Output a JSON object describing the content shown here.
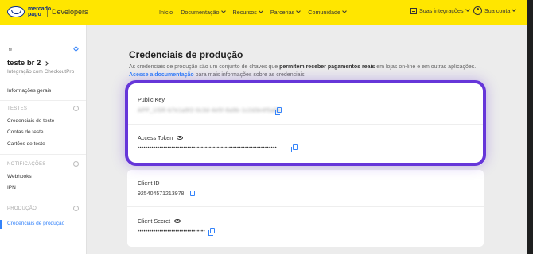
{
  "header": {
    "logo_text_line1": "mercado",
    "logo_text_line2": "pago",
    "product": "Developers",
    "nav": [
      "Início",
      "Documentação",
      "Recursos",
      "Parcerias",
      "Comunidade"
    ],
    "integrations": "Suas integrações",
    "account": "Sua conta"
  },
  "sidebar": {
    "badge": "te",
    "app_name": "teste br 2",
    "app_subtitle": "Integração com CheckoutPro",
    "general_info": "Informações gerais",
    "section_tests": "TESTES",
    "test_credentials": "Credenciais de teste",
    "test_accounts": "Contas de teste",
    "test_cards": "Cartões de teste",
    "section_notifications": "NOTIFICAÇÕES",
    "webhooks": "Webhooks",
    "ipn": "IPN",
    "section_production": "PRODUÇÃO",
    "production_credentials": "Credenciais de produção"
  },
  "main": {
    "title": "Credenciais de produção",
    "desc_part1": "As credenciais de produção são um conjunto de chaves que ",
    "desc_bold": "permitem receber pagamentos reais",
    "desc_part2": " em lojas on-line e em outras aplicações.",
    "desc_link": "Acesse a documentação",
    "desc_part3": " para mais informações sobre as credenciais."
  },
  "credentials": {
    "public_key_label": "Public Key",
    "public_key_value": "APP_USR-b7e1a9f2-0c3d-4e5f-8a9b-1c2d3e4f5a6b",
    "access_token_label": "Access Token",
    "access_token_value": "••••••••••••••••••••••••••••••••••••••••••••••••••••••••••••••••••••••",
    "client_id_label": "Client ID",
    "client_id_value": "925404571213978",
    "client_secret_label": "Client Secret",
    "client_secret_value": "••••••••••••••••••••••••••••••••••"
  },
  "colors": {
    "header_bg": "#ffe600",
    "accent": "#3483fa",
    "highlight": "#6636d9"
  }
}
